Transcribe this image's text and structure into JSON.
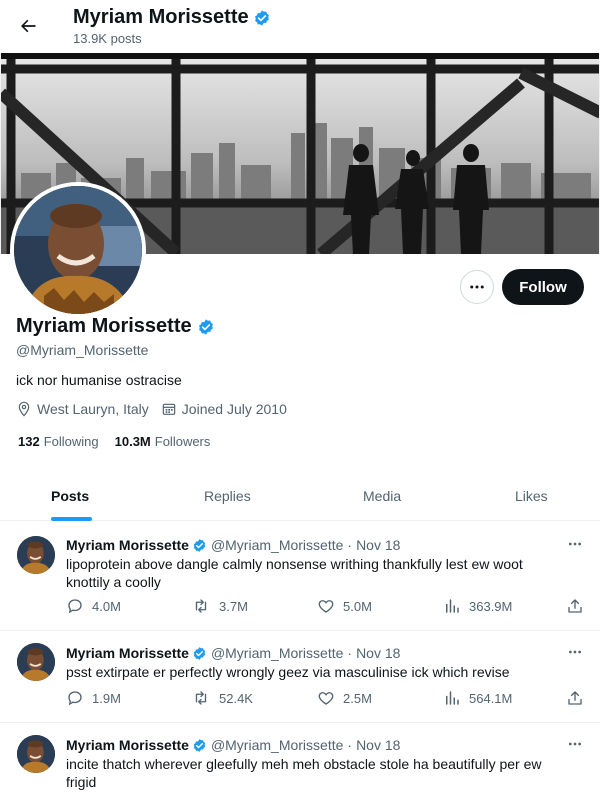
{
  "header": {
    "name": "Myriam Morissette",
    "posts_count": "13.9K posts"
  },
  "profile": {
    "name": "Myriam Morissette",
    "handle": "@Myriam_Morissette",
    "bio": "ick nor humanise ostracise",
    "location": "West Lauryn, Italy",
    "joined": "Joined July 2010",
    "following_count": "132",
    "following_label": "Following",
    "followers_count": "10.3M",
    "followers_label": "Followers",
    "follow_button": "Follow"
  },
  "tabs": [
    {
      "label": "Posts",
      "active": true
    },
    {
      "label": "Replies",
      "active": false
    },
    {
      "label": "Media",
      "active": false
    },
    {
      "label": "Likes",
      "active": false
    }
  ],
  "tweets": [
    {
      "name": "Myriam Morissette",
      "handle": "@Myriam_Morissette",
      "date": "Nov 18",
      "text": "lipoprotein above dangle calmly nonsense writhing thankfully lest ew woot knottily a coolly",
      "replies": "4.0M",
      "retweets": "3.7M",
      "likes": "5.0M",
      "views": "363.9M"
    },
    {
      "name": "Myriam Morissette",
      "handle": "@Myriam_Morissette",
      "date": "Nov 18",
      "text": "psst extirpate er perfectly wrongly geez via masculinise ick which revise",
      "replies": "1.9M",
      "retweets": "52.4K",
      "likes": "2.5M",
      "views": "564.1M"
    },
    {
      "name": "Myriam Morissette",
      "handle": "@Myriam_Morissette",
      "date": "Nov 18",
      "text": "incite thatch wherever gleefully meh meh obstacle stole ha beautifully per ew frigid"
    }
  ],
  "colors": {
    "accent": "#1d9bf0",
    "text": "#0f1419",
    "muted": "#536471",
    "border": "#eff3f4"
  }
}
